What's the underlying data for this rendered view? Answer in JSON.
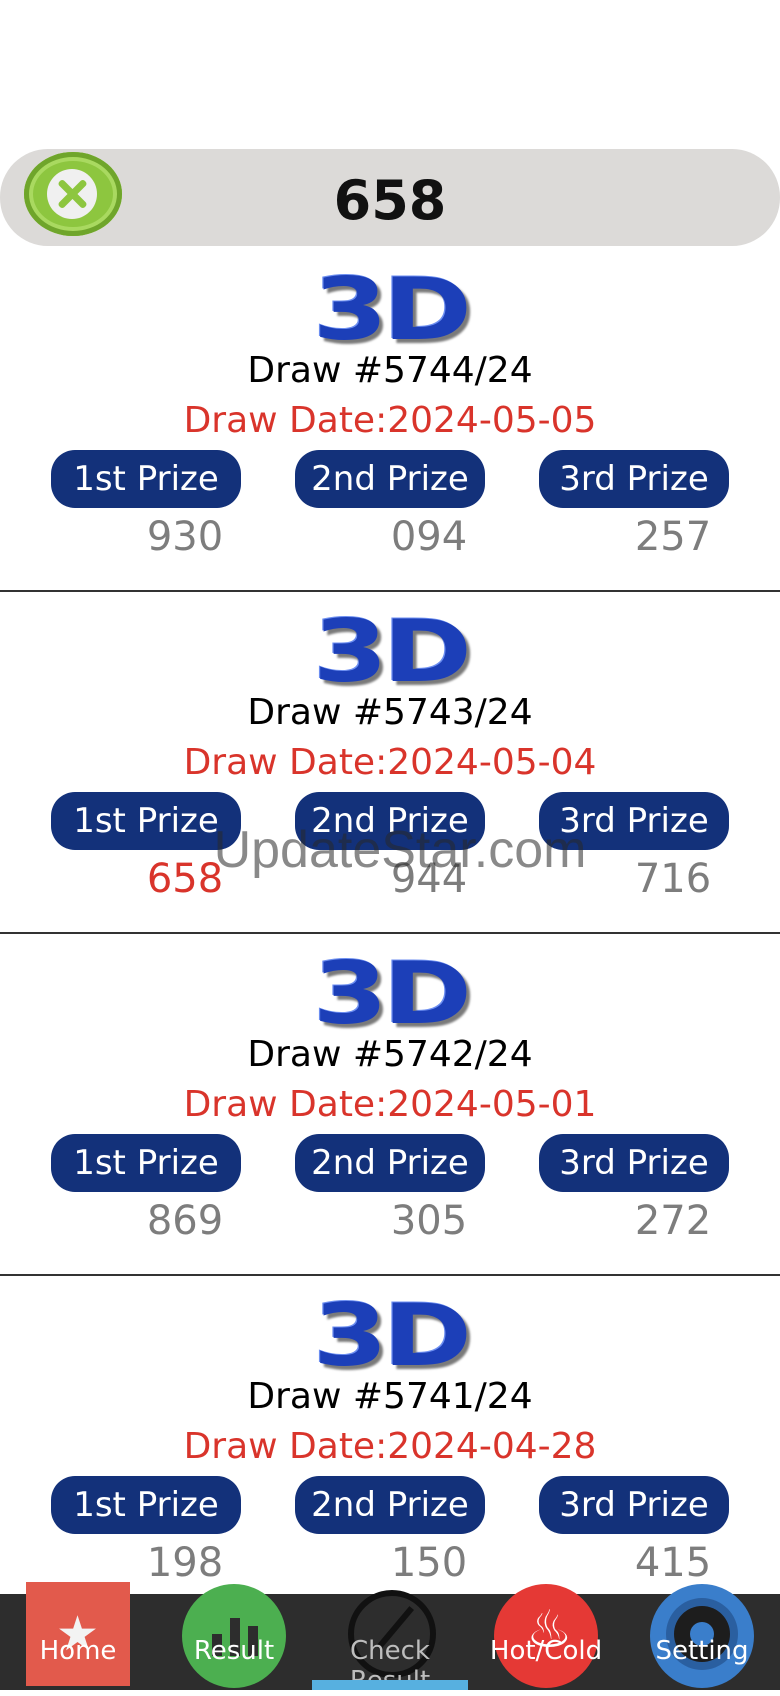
{
  "search": {
    "value": "658"
  },
  "watermark": "UpdateStar.com",
  "logo_text": "3D",
  "prize_labels": [
    "1st Prize",
    "2nd Prize",
    "3rd Prize"
  ],
  "draws": [
    {
      "draw_no": "Draw #5744/24",
      "date": "Draw Date:2024-05-05",
      "prizes": [
        "930",
        "094",
        "257"
      ]
    },
    {
      "draw_no": "Draw #5743/24",
      "date": "Draw Date:2024-05-04",
      "prizes": [
        "658",
        "944",
        "716"
      ]
    },
    {
      "draw_no": "Draw #5742/24",
      "date": "Draw Date:2024-05-01",
      "prizes": [
        "869",
        "305",
        "272"
      ]
    },
    {
      "draw_no": "Draw #5741/24",
      "date": "Draw Date:2024-04-28",
      "prizes": [
        "198",
        "150",
        "415"
      ]
    }
  ],
  "colors": {
    "accent_red": "#d9342b",
    "prize_badge": "#13317a",
    "logo_blue": "#1c3fb8",
    "nav_active": "#57b0e0"
  },
  "nav": {
    "items": [
      {
        "label": "Home",
        "icon": "star-icon"
      },
      {
        "label": "Result",
        "icon": "bar-chart-icon"
      },
      {
        "label": "Check Result",
        "icon": "check-icon"
      },
      {
        "label": "Hot/Cold",
        "icon": "flame-icon"
      },
      {
        "label": "Setting",
        "icon": "gear-icon"
      }
    ],
    "active": "Check Result"
  }
}
